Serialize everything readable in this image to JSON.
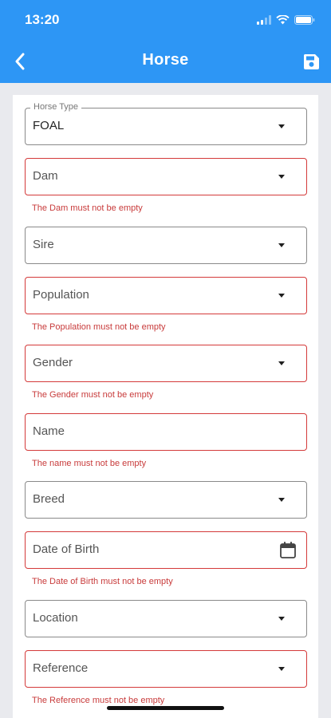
{
  "status_bar": {
    "time": "13:20"
  },
  "nav": {
    "title": "Horse"
  },
  "form": {
    "horse_type": {
      "label": "Horse Type",
      "value": "FOAL"
    },
    "dam": {
      "label": "Dam",
      "error": "The Dam must not be empty"
    },
    "sire": {
      "label": "Sire"
    },
    "population": {
      "label": "Population",
      "error": "The Population must not be empty"
    },
    "gender": {
      "label": "Gender",
      "error": "The Gender must not be empty"
    },
    "name": {
      "label": "Name",
      "error": "The name must not be empty"
    },
    "breed": {
      "label": "Breed"
    },
    "date_of_birth": {
      "label": "Date of Birth",
      "error": "The Date of Birth must not be empty"
    },
    "location": {
      "label": "Location"
    },
    "reference": {
      "label": "Reference",
      "error": "The Reference must not be empty"
    }
  },
  "colors": {
    "primary": "#2d96f5",
    "error": "#d43a3a",
    "background": "#e9eaee"
  },
  "icons": [
    "back-arrow-icon",
    "save-icon",
    "dropdown-caret-icon",
    "calendar-icon",
    "wifi-icon",
    "battery-icon",
    "signal-icon"
  ]
}
